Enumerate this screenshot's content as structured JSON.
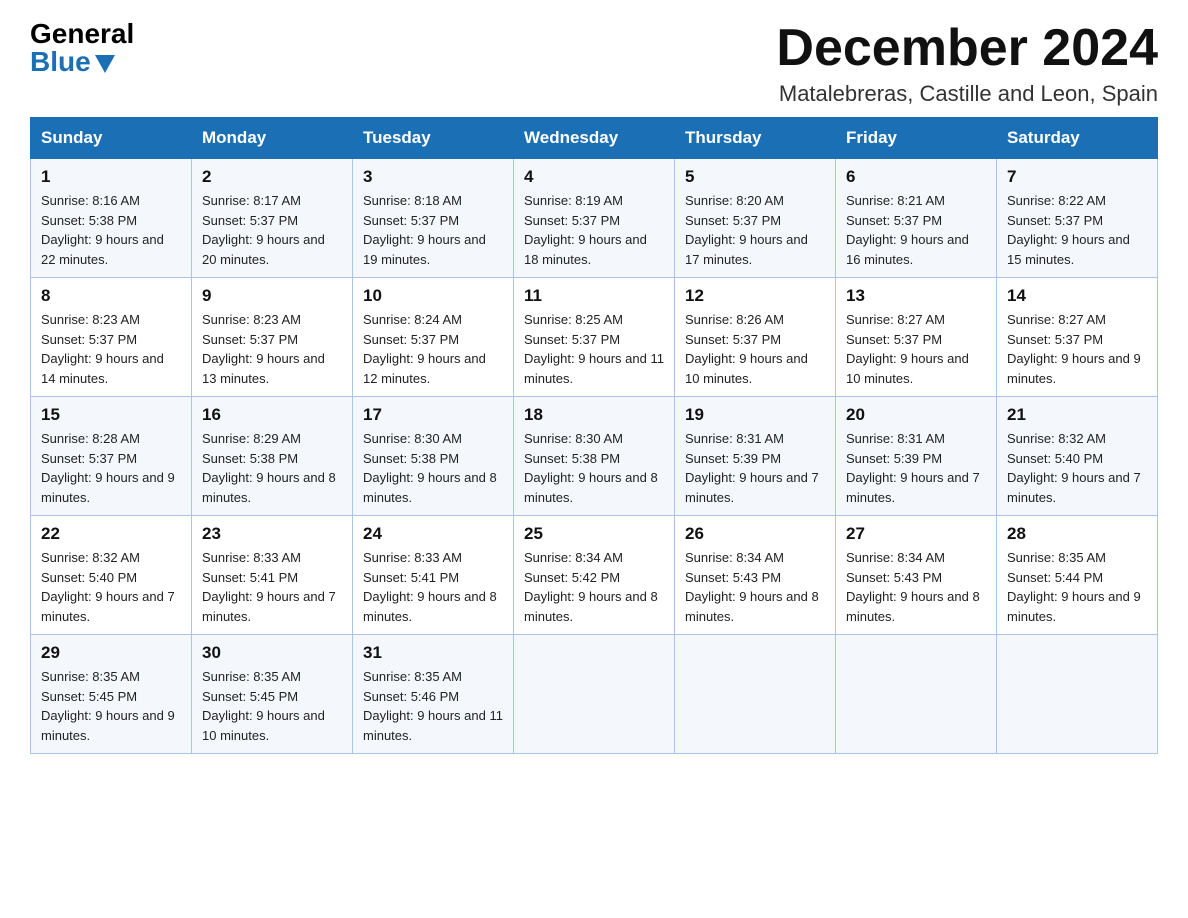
{
  "logo": {
    "general": "General",
    "blue": "Blue"
  },
  "header": {
    "month_year": "December 2024",
    "location": "Matalebreras, Castille and Leon, Spain"
  },
  "weekdays": [
    "Sunday",
    "Monday",
    "Tuesday",
    "Wednesday",
    "Thursday",
    "Friday",
    "Saturday"
  ],
  "weeks": [
    [
      {
        "day": "1",
        "sunrise": "8:16 AM",
        "sunset": "5:38 PM",
        "daylight": "9 hours and 22 minutes."
      },
      {
        "day": "2",
        "sunrise": "8:17 AM",
        "sunset": "5:37 PM",
        "daylight": "9 hours and 20 minutes."
      },
      {
        "day": "3",
        "sunrise": "8:18 AM",
        "sunset": "5:37 PM",
        "daylight": "9 hours and 19 minutes."
      },
      {
        "day": "4",
        "sunrise": "8:19 AM",
        "sunset": "5:37 PM",
        "daylight": "9 hours and 18 minutes."
      },
      {
        "day": "5",
        "sunrise": "8:20 AM",
        "sunset": "5:37 PM",
        "daylight": "9 hours and 17 minutes."
      },
      {
        "day": "6",
        "sunrise": "8:21 AM",
        "sunset": "5:37 PM",
        "daylight": "9 hours and 16 minutes."
      },
      {
        "day": "7",
        "sunrise": "8:22 AM",
        "sunset": "5:37 PM",
        "daylight": "9 hours and 15 minutes."
      }
    ],
    [
      {
        "day": "8",
        "sunrise": "8:23 AM",
        "sunset": "5:37 PM",
        "daylight": "9 hours and 14 minutes."
      },
      {
        "day": "9",
        "sunrise": "8:23 AM",
        "sunset": "5:37 PM",
        "daylight": "9 hours and 13 minutes."
      },
      {
        "day": "10",
        "sunrise": "8:24 AM",
        "sunset": "5:37 PM",
        "daylight": "9 hours and 12 minutes."
      },
      {
        "day": "11",
        "sunrise": "8:25 AM",
        "sunset": "5:37 PM",
        "daylight": "9 hours and 11 minutes."
      },
      {
        "day": "12",
        "sunrise": "8:26 AM",
        "sunset": "5:37 PM",
        "daylight": "9 hours and 10 minutes."
      },
      {
        "day": "13",
        "sunrise": "8:27 AM",
        "sunset": "5:37 PM",
        "daylight": "9 hours and 10 minutes."
      },
      {
        "day": "14",
        "sunrise": "8:27 AM",
        "sunset": "5:37 PM",
        "daylight": "9 hours and 9 minutes."
      }
    ],
    [
      {
        "day": "15",
        "sunrise": "8:28 AM",
        "sunset": "5:37 PM",
        "daylight": "9 hours and 9 minutes."
      },
      {
        "day": "16",
        "sunrise": "8:29 AM",
        "sunset": "5:38 PM",
        "daylight": "9 hours and 8 minutes."
      },
      {
        "day": "17",
        "sunrise": "8:30 AM",
        "sunset": "5:38 PM",
        "daylight": "9 hours and 8 minutes."
      },
      {
        "day": "18",
        "sunrise": "8:30 AM",
        "sunset": "5:38 PM",
        "daylight": "9 hours and 8 minutes."
      },
      {
        "day": "19",
        "sunrise": "8:31 AM",
        "sunset": "5:39 PM",
        "daylight": "9 hours and 7 minutes."
      },
      {
        "day": "20",
        "sunrise": "8:31 AM",
        "sunset": "5:39 PM",
        "daylight": "9 hours and 7 minutes."
      },
      {
        "day": "21",
        "sunrise": "8:32 AM",
        "sunset": "5:40 PM",
        "daylight": "9 hours and 7 minutes."
      }
    ],
    [
      {
        "day": "22",
        "sunrise": "8:32 AM",
        "sunset": "5:40 PM",
        "daylight": "9 hours and 7 minutes."
      },
      {
        "day": "23",
        "sunrise": "8:33 AM",
        "sunset": "5:41 PM",
        "daylight": "9 hours and 7 minutes."
      },
      {
        "day": "24",
        "sunrise": "8:33 AM",
        "sunset": "5:41 PM",
        "daylight": "9 hours and 8 minutes."
      },
      {
        "day": "25",
        "sunrise": "8:34 AM",
        "sunset": "5:42 PM",
        "daylight": "9 hours and 8 minutes."
      },
      {
        "day": "26",
        "sunrise": "8:34 AM",
        "sunset": "5:43 PM",
        "daylight": "9 hours and 8 minutes."
      },
      {
        "day": "27",
        "sunrise": "8:34 AM",
        "sunset": "5:43 PM",
        "daylight": "9 hours and 8 minutes."
      },
      {
        "day": "28",
        "sunrise": "8:35 AM",
        "sunset": "5:44 PM",
        "daylight": "9 hours and 9 minutes."
      }
    ],
    [
      {
        "day": "29",
        "sunrise": "8:35 AM",
        "sunset": "5:45 PM",
        "daylight": "9 hours and 9 minutes."
      },
      {
        "day": "30",
        "sunrise": "8:35 AM",
        "sunset": "5:45 PM",
        "daylight": "9 hours and 10 minutes."
      },
      {
        "day": "31",
        "sunrise": "8:35 AM",
        "sunset": "5:46 PM",
        "daylight": "9 hours and 11 minutes."
      },
      null,
      null,
      null,
      null
    ]
  ]
}
